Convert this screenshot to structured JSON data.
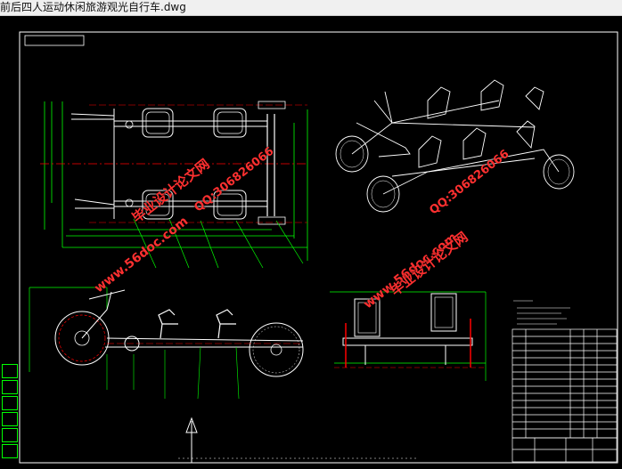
{
  "window": {
    "title": "前后四人运动休闲旅游观光自行车.dwg"
  },
  "watermarks": {
    "site": "www.56doc.com",
    "brand": "毕业设计论文网",
    "qq": "QQ:306826066"
  },
  "colors": {
    "background": "#000000",
    "frame_lines": "#ffffff",
    "leader_lines": "#00ff00",
    "dimension_lines": "#ff0000",
    "watermark": "#ff3030"
  }
}
